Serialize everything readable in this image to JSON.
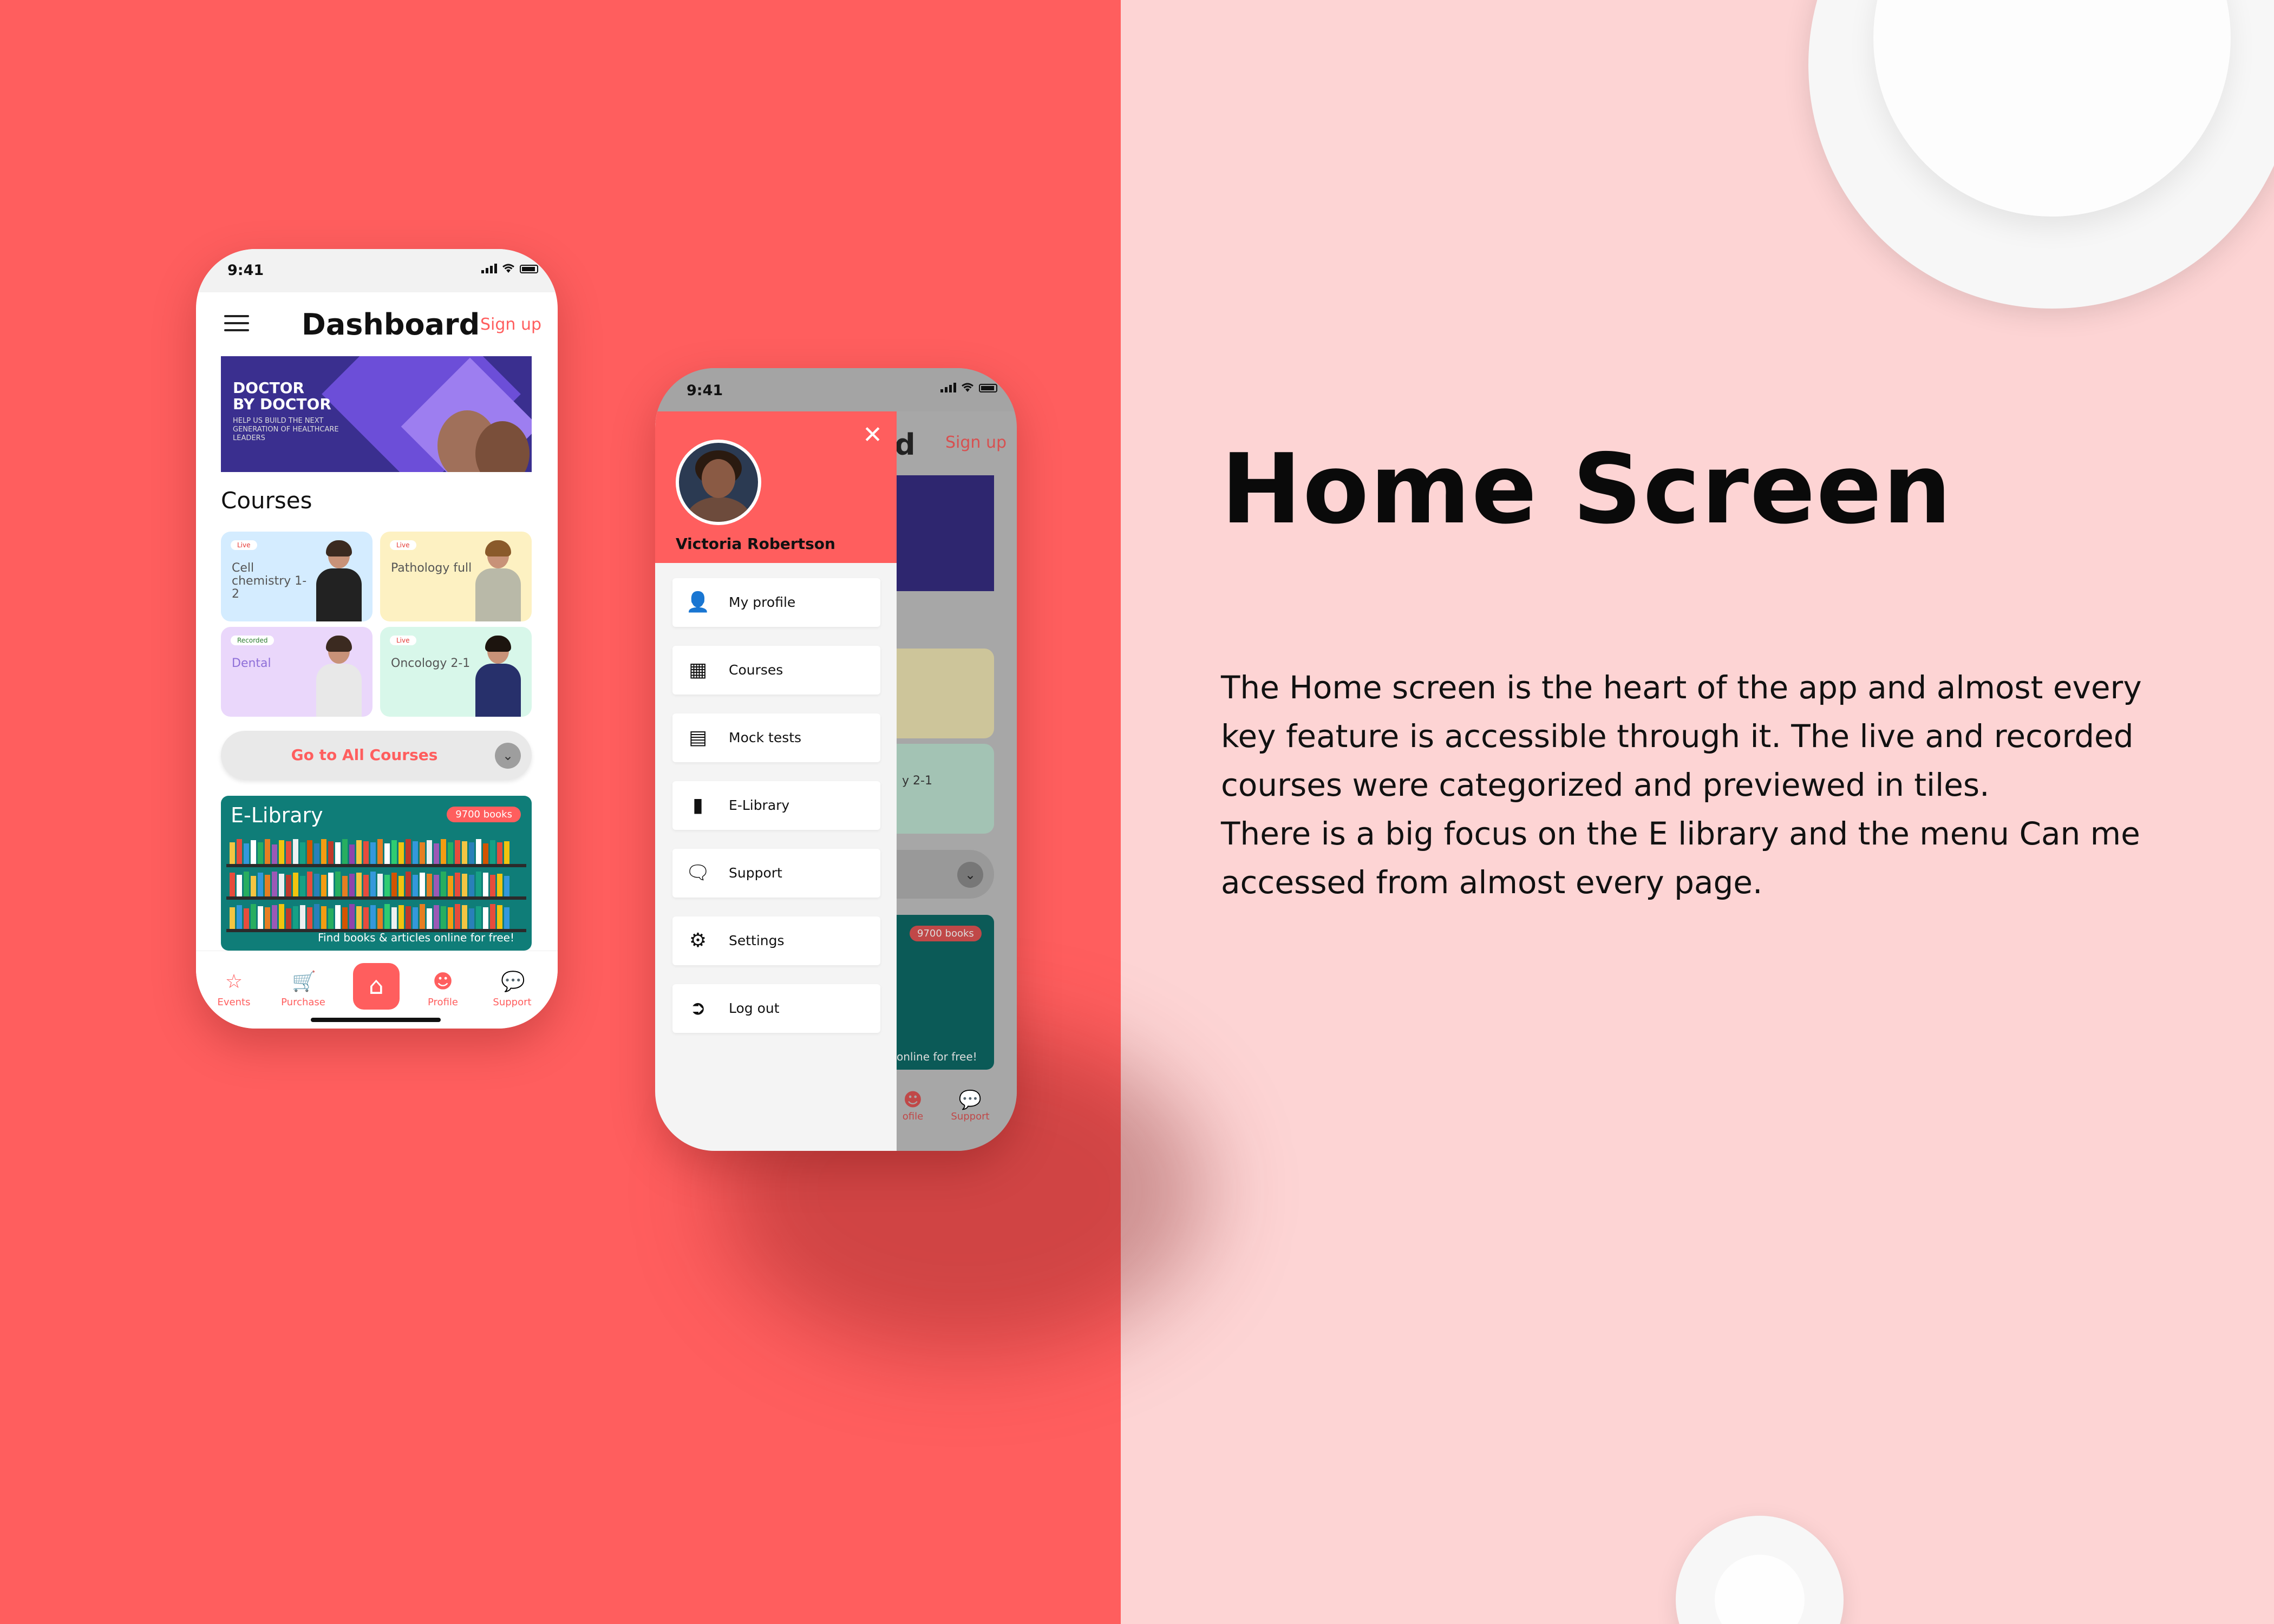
{
  "presentation": {
    "heading": "Home Screen",
    "description": [
      "The Home screen is the heart of the app and almost every key feature is accessible through it. The live and recorded courses were categorized and previewed in tiles.",
      "There is a big focus on the E library and the menu Can me accessed from almost every page."
    ]
  },
  "phone_dashboard": {
    "status_time": "9:41",
    "title": "Dashboard",
    "signup_label": "Sign up",
    "banner": {
      "headline_line1": "DOCTOR",
      "headline_line2": "BY DOCTOR",
      "tagline": "HELP US BUILD THE NEXT GENERATION OF HEALTHCARE LEADERS"
    },
    "courses_title": "Courses",
    "courses": [
      {
        "badge": "Live",
        "label": "Cell chemistry 1-2",
        "color": "#d4ecff"
      },
      {
        "badge": "Live",
        "label": "Pathology full",
        "color": "#fdf1c2"
      },
      {
        "badge": "Recorded",
        "label": "Dental",
        "color": "#ead7fb"
      },
      {
        "badge": "Live",
        "label": "Oncology 2-1",
        "color": "#d8f7ea"
      }
    ],
    "go_all_label": "Go to All Courses",
    "elibrary": {
      "title": "E-Library",
      "badge": "9700 books",
      "caption": "Find books & articles online for free!"
    },
    "tabs": {
      "events": "Events",
      "purchase": "Purchase",
      "profile": "Profile",
      "support": "Support"
    }
  },
  "phone_menu": {
    "status_time": "9:41",
    "user_name": "Victoria Robertson",
    "menu_items": [
      {
        "label": "My profile"
      },
      {
        "label": "Courses"
      },
      {
        "label": "Mock tests"
      },
      {
        "label": "E-Library"
      },
      {
        "label": "Support"
      },
      {
        "label": "Settings"
      },
      {
        "label": "Log out"
      }
    ],
    "background": {
      "title_fragment": "d",
      "signup_label": "Sign up",
      "tile_fragment": "y 2-1",
      "badge": "9700 books",
      "caption_fragment": "online for free!",
      "tab_profile_fragment": "ofile",
      "tab_support": "Support"
    }
  },
  "colors": {
    "brand": "#ff5e5e",
    "panel_right": "#fdd4d4",
    "elibrary": "#0f7d78"
  }
}
